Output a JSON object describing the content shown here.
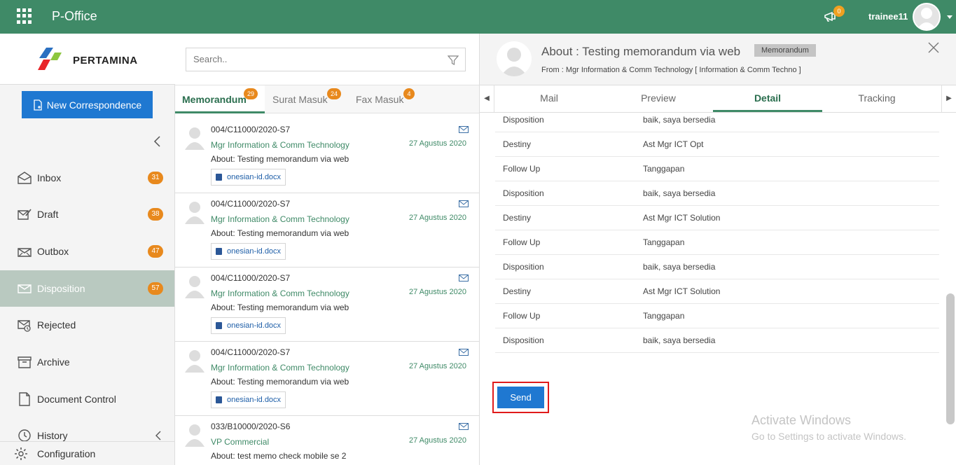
{
  "app": {
    "title": "P-Office"
  },
  "topbar": {
    "notification_count": "0",
    "username": "trainee11"
  },
  "brand": {
    "logo_text": "PERTAMINA"
  },
  "sidebar": {
    "new_button": "New Correspondence",
    "items": [
      {
        "label": "Inbox",
        "badge": "31",
        "icon": "inbox-icon"
      },
      {
        "label": "Draft",
        "badge": "38",
        "icon": "draft-icon"
      },
      {
        "label": "Outbox",
        "badge": "47",
        "icon": "outbox-icon"
      },
      {
        "label": "Disposition",
        "badge": "57",
        "icon": "disposition-icon",
        "active": true
      },
      {
        "label": "Rejected",
        "icon": "rejected-icon"
      },
      {
        "label": "Archive",
        "icon": "archive-icon"
      },
      {
        "label": "Document Control",
        "icon": "document-control-icon"
      },
      {
        "label": "History",
        "icon": "history-icon"
      }
    ],
    "config_label": "Configuration"
  },
  "list": {
    "search_placeholder": "Search..",
    "tabs": [
      {
        "label": "Memorandum",
        "badge": "29"
      },
      {
        "label": "Surat Masuk",
        "badge": "24"
      },
      {
        "label": "Fax Masuk",
        "badge": "4"
      }
    ],
    "items": [
      {
        "number": "004/C11000/2020-S7",
        "sender": "Mgr Information & Comm Technology",
        "subject": "About: Testing memorandum via web",
        "date": "27 Agustus 2020",
        "attachment": "onesian-id.docx"
      },
      {
        "number": "004/C11000/2020-S7",
        "sender": "Mgr Information & Comm Technology",
        "subject": "About: Testing memorandum via web",
        "date": "27 Agustus 2020",
        "attachment": "onesian-id.docx"
      },
      {
        "number": "004/C11000/2020-S7",
        "sender": "Mgr Information & Comm Technology",
        "subject": "About: Testing memorandum via web",
        "date": "27 Agustus 2020",
        "attachment": "onesian-id.docx"
      },
      {
        "number": "004/C11000/2020-S7",
        "sender": "Mgr Information & Comm Technology",
        "subject": "About: Testing memorandum via web",
        "date": "27 Agustus 2020",
        "attachment": "onesian-id.docx"
      },
      {
        "number": "033/B10000/2020-S6",
        "sender": "VP Commercial",
        "subject": "About: test memo check mobile se 2",
        "date": "27 Agustus 2020"
      }
    ]
  },
  "detail": {
    "title": "About : Testing memorandum via web",
    "tag": "Memorandum",
    "from": "From : Mgr Information & Comm Technology [ Information & Comm Techno ]",
    "tabs": [
      "Mail",
      "Preview",
      "Detail",
      "Tracking"
    ],
    "active_tab": "Detail",
    "rows": [
      {
        "key": "Disposition",
        "value": "baik, saya bersedia"
      },
      {
        "key": "Destiny",
        "value": "Ast Mgr ICT Opt"
      },
      {
        "key": "Follow Up",
        "value": "Tanggapan"
      },
      {
        "key": "Disposition",
        "value": "baik, saya bersedia"
      },
      {
        "key": "Destiny",
        "value": "Ast Mgr ICT Solution"
      },
      {
        "key": "Follow Up",
        "value": "Tanggapan"
      },
      {
        "key": "Disposition",
        "value": "baik, saya bersedia"
      },
      {
        "key": "Destiny",
        "value": "Ast Mgr ICT Solution"
      },
      {
        "key": "Follow Up",
        "value": "Tanggapan"
      },
      {
        "key": "Disposition",
        "value": "baik, saya bersedia"
      }
    ],
    "send_label": "Send"
  },
  "watermark": {
    "line1": "Activate Windows",
    "line2": "Go to Settings to activate Windows."
  },
  "colors": {
    "topbar": "#3f8a67",
    "accent_blue": "#1f78d1",
    "badge_orange": "#e8891d",
    "active_nav": "#b9c9c0",
    "highlight_red": "#e01b1b"
  }
}
